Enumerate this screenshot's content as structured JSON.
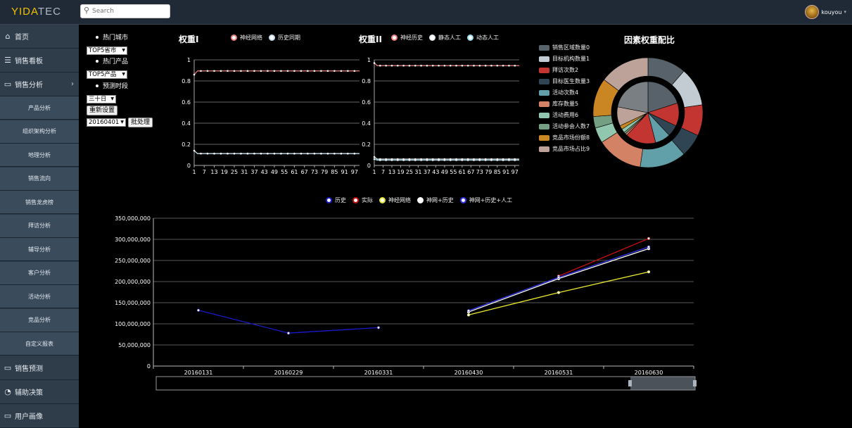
{
  "topbar": {
    "logo_a": "YIDA",
    "logo_b": "TEC",
    "search_placeholder": "Search",
    "user_name": "kouyou"
  },
  "sidebar": {
    "items": [
      {
        "label": "首页",
        "type": "main",
        "icon": "home-icon"
      },
      {
        "label": "销售看板",
        "type": "main",
        "icon": "document-icon"
      },
      {
        "label": "销售分析",
        "type": "main",
        "icon": "monitor-icon",
        "expanded": true
      },
      {
        "label": "产品分析",
        "type": "sub"
      },
      {
        "label": "组织架构分析",
        "type": "sub"
      },
      {
        "label": "地理分析",
        "type": "sub"
      },
      {
        "label": "销售流向",
        "type": "sub"
      },
      {
        "label": "销售龙虎榜",
        "type": "sub"
      },
      {
        "label": "拜访分析",
        "type": "sub"
      },
      {
        "label": "辅导分析",
        "type": "sub"
      },
      {
        "label": "客户分析",
        "type": "sub"
      },
      {
        "label": "活动分析",
        "type": "sub"
      },
      {
        "label": "竞品分析",
        "type": "sub"
      },
      {
        "label": "自定义报表",
        "type": "sub"
      },
      {
        "label": "销售预测",
        "type": "main",
        "icon": "monitor-icon"
      },
      {
        "label": "辅助决策",
        "type": "main",
        "icon": "pie-chart-icon"
      },
      {
        "label": "用户画像",
        "type": "main",
        "icon": "monitor-icon"
      }
    ]
  },
  "controls": {
    "hot_city": "热门城市",
    "top5_city": "TOP5省市",
    "hot_product": "热门产品",
    "top5_product": "TOP5产品",
    "forecast_period": "预测时段",
    "period_value": "三十日",
    "reset": "重新设置",
    "date_value": "20160401",
    "batch": "批处理"
  },
  "chart_data": [
    {
      "type": "line",
      "title": "权重I",
      "x_ticks": [
        "1",
        "7",
        "13",
        "19",
        "25",
        "31",
        "37",
        "43",
        "49",
        "55",
        "61",
        "67",
        "73",
        "79",
        "85",
        "91",
        "97"
      ],
      "x_range": [
        1,
        100
      ],
      "ylim": [
        0,
        1
      ],
      "y_ticks": [
        "0",
        "0.2",
        "0.4",
        "0.6",
        "0.8",
        "1"
      ],
      "grid": true,
      "series": [
        {
          "name": "神经网络",
          "color": "#f08080",
          "start": 0.86,
          "plateau": 0.895
        },
        {
          "name": "历史同期",
          "color": "#c8e0ee",
          "start": 0.14,
          "plateau": 0.112
        }
      ]
    },
    {
      "type": "line",
      "title": "权重II",
      "x_ticks": [
        "1",
        "7",
        "13",
        "19",
        "25",
        "31",
        "37",
        "43",
        "49",
        "55",
        "61",
        "67",
        "73",
        "79",
        "85",
        "91",
        "97"
      ],
      "x_range": [
        1,
        100
      ],
      "ylim": [
        0,
        1
      ],
      "y_ticks": [
        "0",
        "0.2",
        "0.4",
        "0.6",
        "0.8",
        "1"
      ],
      "grid": true,
      "series": [
        {
          "name": "神经历史",
          "color": "#f08080",
          "start": 0.97,
          "plateau": 0.945
        },
        {
          "name": "静态人工",
          "color": "#e6eef2",
          "start": 0.08,
          "plateau": 0.06
        },
        {
          "name": "动态人工",
          "color": "#9fe0ee",
          "start": 0.06,
          "plateau": 0.05
        }
      ]
    },
    {
      "type": "pie",
      "title": "因素权重配比",
      "categories": [
        "销售区域数量0",
        "目标机构数量1",
        "拜访次数2",
        "目标医生数量3",
        "活动次数4",
        "库存数量5",
        "活动费用6",
        "活动参会人数7",
        "竞品市场份额8",
        "竞品市场占比9"
      ],
      "colors": [
        "#58626a",
        "#c3cbd3",
        "#c23531",
        "#2f4554",
        "#61a0a8",
        "#d48265",
        "#91c7ae",
        "#749f83",
        "#ca8622",
        "#bda29a"
      ],
      "outer_values": [
        10,
        10,
        8,
        6,
        12,
        12,
        4,
        3,
        10,
        13
      ],
      "inner_values": [
        20,
        12,
        6,
        8,
        16,
        1,
        1,
        2,
        2,
        10,
        22
      ],
      "inner_colors": [
        "#58626a",
        "#c23531",
        "#2f4554",
        "#61a0a8",
        "#c23531",
        "#d48265",
        "#749f83",
        "#91c7ae",
        "#ca8622",
        "#bda29a",
        "#7a7f84"
      ]
    },
    {
      "type": "line",
      "title": "",
      "categories": [
        "20160131",
        "20160229",
        "20160331",
        "20160430",
        "20160531",
        "20160630"
      ],
      "ylim": [
        0,
        350000000
      ],
      "y_ticks": [
        "0",
        "50,000,000",
        "100,000,000",
        "150,000,000",
        "200,000,000",
        "250,000,000",
        "300,000,000",
        "350,000,000"
      ],
      "grid": true,
      "series": [
        {
          "name": "历史",
          "color": "#1a1acc",
          "values": [
            132000000,
            78000000,
            91000000,
            null,
            null,
            null
          ]
        },
        {
          "name": "实际",
          "color": "#cc1010",
          "values": [
            null,
            null,
            null,
            null,
            213000000,
            302000000
          ]
        },
        {
          "name": "神经网络",
          "color": "#e8e830",
          "values": [
            null,
            null,
            null,
            121000000,
            174000000,
            223000000
          ]
        },
        {
          "name": "神网+历史",
          "color": "#ffffff",
          "values": [
            null,
            null,
            null,
            128000000,
            207000000,
            278000000
          ]
        },
        {
          "name": "神网+历史+人工",
          "color": "#3333ee",
          "values": [
            null,
            null,
            null,
            131000000,
            210000000,
            282000000
          ]
        }
      ]
    }
  ]
}
